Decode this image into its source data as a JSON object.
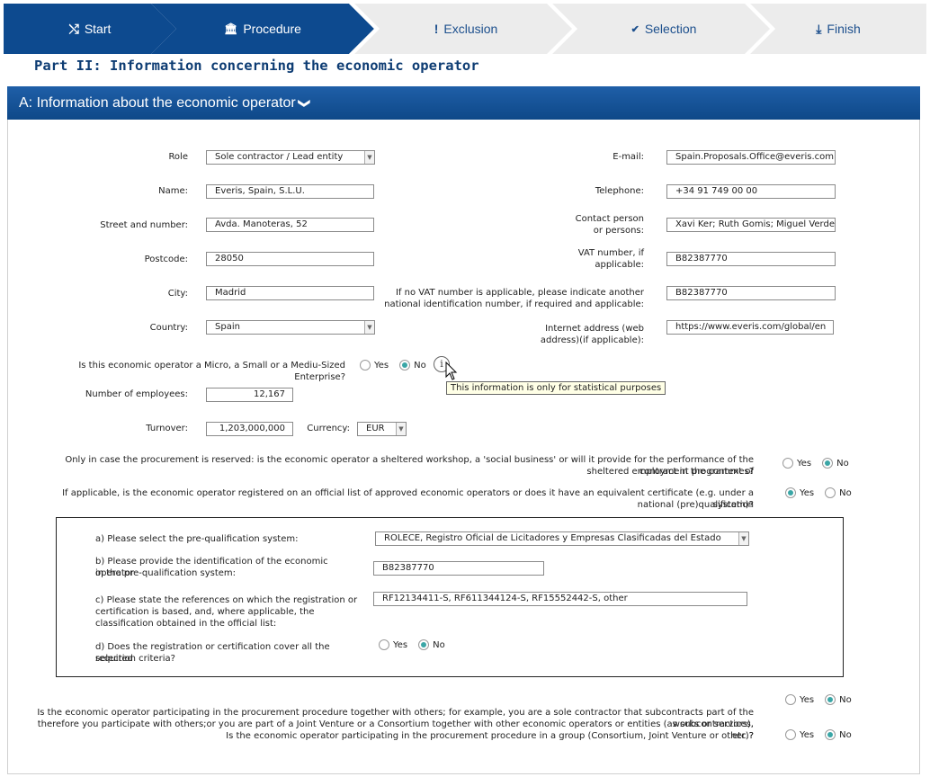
{
  "wizard": {
    "steps": [
      {
        "label": "Start",
        "icon": "shuffle-icon",
        "glyph": "⤭",
        "state": "active"
      },
      {
        "label": "Procedure",
        "icon": "institution-icon",
        "glyph": "🏛",
        "state": "active"
      },
      {
        "label": "Exclusion",
        "icon": "exclamation-icon",
        "glyph": "!",
        "state": "inactive"
      },
      {
        "label": "Selection",
        "icon": "check-circle-icon",
        "glyph": "✔",
        "state": "inactive"
      },
      {
        "label": "Finish",
        "icon": "download-icon",
        "glyph": "⤓",
        "state": "inactive"
      }
    ]
  },
  "part_title": "Part II: Information concerning the economic operator",
  "section": {
    "title": "A: Information about the economic operator",
    "chevron": "❯"
  },
  "form": {
    "role": {
      "label": "Role",
      "value": "Sole contractor / Lead entity"
    },
    "name": {
      "label": "Name:",
      "value": "Everis, Spain, S.L.U."
    },
    "street": {
      "label": "Street and number:",
      "value": "Avda. Manoteras, 52"
    },
    "postcode": {
      "label": "Postcode:",
      "value": "28050"
    },
    "city": {
      "label": "City:",
      "value": "Madrid"
    },
    "country": {
      "label": "Country:",
      "value": "Spain"
    },
    "email": {
      "label": "E-mail:",
      "value": "Spain.Proposals.Office@everis.com"
    },
    "telephone": {
      "label": "Telephone:",
      "value": "+34 91 749 00 00"
    },
    "contact": {
      "label_1": "Contact person",
      "label_2": "or persons:",
      "value": "Xavi Ker; Ruth Gomis; Miguel Verde"
    },
    "vat": {
      "label_1": "VAT number, if",
      "label_2": "applicable:",
      "value": "B82387770"
    },
    "national_id": {
      "label_1": "If no VAT number is applicable, please indicate another",
      "label_2": "national identification number, if required and applicable:",
      "value": "B82387770"
    },
    "internet": {
      "label_1": "Internet address (web",
      "label_2": "address)(if applicable):",
      "value": "https://www.everis.com/global/en"
    },
    "sme": {
      "question": "Is this economic operator a Micro, a Small or a Mediu-Sized Enterprise?",
      "yes": "Yes",
      "no": "No",
      "selected": "no"
    },
    "info_glyph": "i",
    "tooltip": "This information is only for statistical purposes",
    "employees": {
      "label": "Number of employees:",
      "value": "12,167"
    },
    "turnover": {
      "label": "Turnover:",
      "value": "1,203,000,000"
    },
    "currency": {
      "label": "Currency:",
      "value": "EUR"
    },
    "sheltered": {
      "line_1": "Only in case the procurement is reserved: is the economic operator a sheltered workshop, a 'social business' or will it provide for the performance of the contract in the context of",
      "line_2": "sheltered employment programmes?",
      "yes": "Yes",
      "no": "No",
      "selected": "no"
    },
    "registered": {
      "line_1": "If applicable, is the economic operator registered on an official list of approved economic operators or does it have an equivalent certificate (e.g. under a national (pre)qualification",
      "line_2": "system)?",
      "yes": "Yes",
      "no": "No",
      "selected": "yes"
    },
    "prequal": {
      "a_label": "a) Please select the pre-qualification system:",
      "a_value": "ROLECE, Registro Oficial de Licitadores y Empresas Clasificadas del Estado",
      "b_label_1": "b) Please provide the identification of the economic operator",
      "b_label_2": "in the pre-qualification system:",
      "b_value": "B82387770",
      "c_label_1": "c) Please state the references on which the registration or",
      "c_label_2": "certification is based, and, where applicable, the",
      "c_label_3": "classification obtained in the official list:",
      "c_value": "RF12134411-S, RF611344124-S, RF15552442-S, other",
      "d_label_1": "d) Does the registration or certification cover all the required",
      "d_label_2": "selection criteria?",
      "d_yes": "Yes",
      "d_no": "No",
      "d_selected": "no"
    },
    "together": {
      "line_1": "Is the economic operator participating in the procurement procedure together with others; for example, you are a sole contractor that subcontracts part of the works or services,",
      "line_2": "therefore you participate with others;or you are part of a Joint Venture or a Consortium together with other economic operators or entities (as subcontractors), etc.?",
      "yes": "Yes",
      "no": "No",
      "selected": "no"
    },
    "group": {
      "question": "Is the economic operator participating in the procurement procedure in a group (Consortium, Joint Venture or other)?",
      "yes": "Yes",
      "no": "No",
      "selected": "no"
    }
  }
}
